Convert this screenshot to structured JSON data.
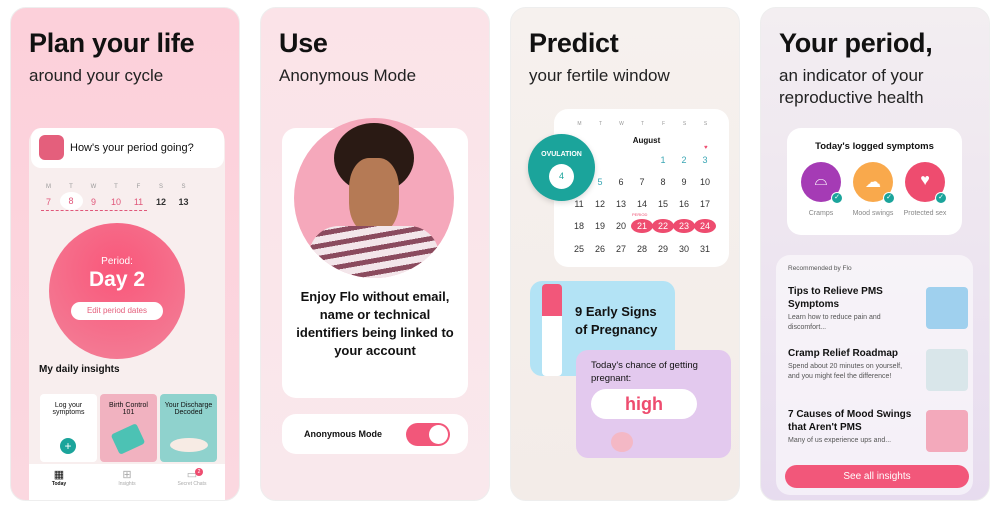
{
  "panels": [
    {
      "title": "Plan your life",
      "subtitle": "around your cycle",
      "prompt": "How's your period going?",
      "weekdays": [
        "M",
        "T",
        "W",
        "T",
        "F",
        "S",
        "S"
      ],
      "days": [
        "7",
        "8",
        "9",
        "10",
        "11",
        "12",
        "13"
      ],
      "period_label": "Period:",
      "period_day": "Day 2",
      "edit_button": "Edit period dates",
      "insights_title": "My daily insights",
      "insight_cards": [
        "Log your symptoms",
        "Birth Control 101",
        "Your Discharge Decoded"
      ],
      "nav": [
        {
          "label": "Today",
          "icon": "calendar-icon"
        },
        {
          "label": "Insights",
          "icon": "grid-icon"
        },
        {
          "label": "Secret Chats",
          "icon": "chat-icon",
          "badge": "2"
        }
      ]
    },
    {
      "title": "Use",
      "subtitle": "Anonymous Mode",
      "body": "Enjoy Flo without email, name or technical identifiers being linked to your account",
      "toggle_label": "Anonymous Mode",
      "toggle_on": true
    },
    {
      "title": "Predict",
      "subtitle": "your fertile window",
      "month": "August",
      "weekdays": [
        "M",
        "T",
        "W",
        "T",
        "F",
        "S",
        "S"
      ],
      "ovulation_label": "OVULATION",
      "ovulation_day": "4",
      "weeks": [
        [
          "",
          "",
          "",
          "",
          "1",
          "2",
          "3"
        ],
        [
          "",
          "5",
          "6",
          "7",
          "8",
          "9",
          "10"
        ],
        [
          "11",
          "12",
          "13",
          "14",
          "15",
          "16",
          "17"
        ],
        [
          "18",
          "19",
          "20",
          "21",
          "22",
          "23",
          "24"
        ],
        [
          "25",
          "26",
          "27",
          "28",
          "29",
          "30",
          "31"
        ]
      ],
      "period_tag": "PERIOD",
      "article": "9 Early Signs of Pregnancy",
      "chance_label": "Today's chance of getting pregnant:",
      "chance_value": "high"
    },
    {
      "title": "Your period,",
      "subtitle": "an indicator of your reproductive health",
      "symptoms_title": "Today's logged symptoms",
      "symptoms": [
        {
          "label": "Cramps",
          "color": "#a53bb5"
        },
        {
          "label": "Mood swings",
          "color": "#f9a94c"
        },
        {
          "label": "Protected sex",
          "color": "#ee4c6f"
        }
      ],
      "recommended": "Recommended by Flo",
      "articles": [
        {
          "title": "Tips to Relieve PMS Symptoms",
          "summary": "Learn how to reduce pain and discomfort..."
        },
        {
          "title": "Cramp Relief Roadmap",
          "summary": "Spend about 20 minutes on yourself, and you might feel the difference!"
        },
        {
          "title": "7 Causes of Mood Swings that Aren't PMS",
          "summary": "Many of us experience ups and..."
        }
      ],
      "cta": "See all insights"
    }
  ],
  "colors": {
    "accent": "#ee4c6f",
    "teal": "#1ba49b"
  }
}
